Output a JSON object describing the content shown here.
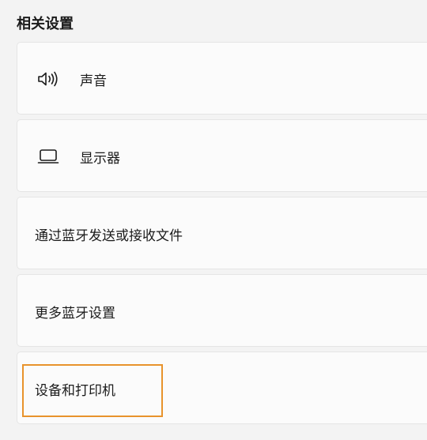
{
  "section": {
    "title": "相关设置"
  },
  "items": [
    {
      "label": "声音",
      "icon": "speaker-icon"
    },
    {
      "label": "显示器",
      "icon": "laptop-icon"
    },
    {
      "label": "通过蓝牙发送或接收文件",
      "icon": null
    },
    {
      "label": "更多蓝牙设置",
      "icon": null
    },
    {
      "label": "设备和打印机",
      "icon": null
    }
  ],
  "colors": {
    "background": "#f3f3f3",
    "card": "#fbfbfb",
    "card_border": "#e5e5e5",
    "highlight": "#e8932c"
  }
}
